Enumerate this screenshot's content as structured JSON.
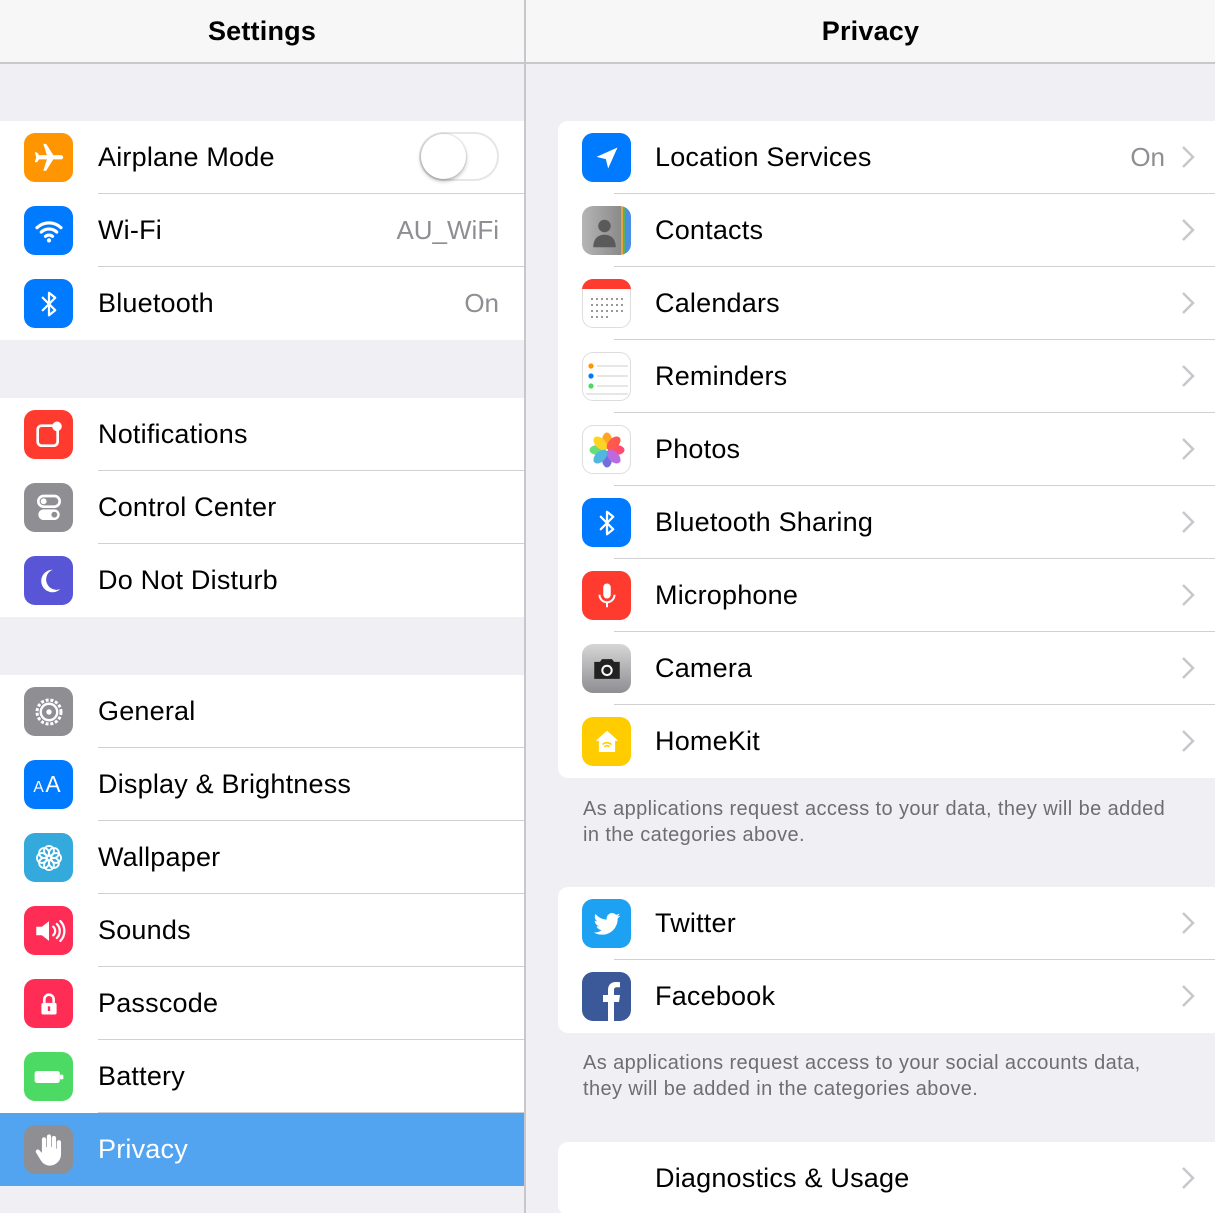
{
  "left": {
    "title": "Settings",
    "groups": [
      [
        {
          "label": "Airplane Mode",
          "icon": "airplane-icon",
          "color": "#ff9500",
          "control": "toggle",
          "toggle_on": false
        },
        {
          "label": "Wi-Fi",
          "icon": "wifi-icon",
          "color": "#007aff",
          "value": "AU_WiFi"
        },
        {
          "label": "Bluetooth",
          "icon": "bluetooth-icon",
          "color": "#007aff",
          "value": "On"
        }
      ],
      [
        {
          "label": "Notifications",
          "icon": "notifications-icon",
          "color": "#ff3b30"
        },
        {
          "label": "Control Center",
          "icon": "control-center-icon",
          "color": "#8e8e93"
        },
        {
          "label": "Do Not Disturb",
          "icon": "moon-icon",
          "color": "#5856d6"
        }
      ],
      [
        {
          "label": "General",
          "icon": "gear-icon",
          "color": "#8e8e93"
        },
        {
          "label": "Display & Brightness",
          "icon": "display-brightness-icon",
          "color": "#007aff"
        },
        {
          "label": "Wallpaper",
          "icon": "wallpaper-icon",
          "color": "#34aadc"
        },
        {
          "label": "Sounds",
          "icon": "speaker-icon",
          "color": "#ff2d55"
        },
        {
          "label": "Passcode",
          "icon": "lock-icon",
          "color": "#ff2d55"
        },
        {
          "label": "Battery",
          "icon": "battery-icon",
          "color": "#4cd964"
        },
        {
          "label": "Privacy",
          "icon": "hand-icon",
          "color": "#8e8e93",
          "selected": true
        }
      ]
    ]
  },
  "right": {
    "title": "Privacy",
    "group1": [
      {
        "label": "Location Services",
        "icon": "location-arrow-icon",
        "color": "#007aff",
        "value": "On"
      },
      {
        "label": "Contacts",
        "icon": "contacts-icon",
        "color": "#9a9a9a"
      },
      {
        "label": "Calendars",
        "icon": "calendar-icon",
        "color": "#ffffff"
      },
      {
        "label": "Reminders",
        "icon": "reminders-icon",
        "color": "#ffffff"
      },
      {
        "label": "Photos",
        "icon": "photos-icon",
        "color": "#ffffff"
      },
      {
        "label": "Bluetooth Sharing",
        "icon": "bluetooth-icon",
        "color": "#007aff"
      },
      {
        "label": "Microphone",
        "icon": "microphone-icon",
        "color": "#ff3b30"
      },
      {
        "label": "Camera",
        "icon": "camera-icon",
        "color": "#8e8e93"
      },
      {
        "label": "HomeKit",
        "icon": "homekit-icon",
        "color": "#ffcc00"
      }
    ],
    "footer1": "As applications request access to your data, they will be added in the categories above.",
    "group2": [
      {
        "label": "Twitter",
        "icon": "twitter-icon",
        "color": "#1da1f2"
      },
      {
        "label": "Facebook",
        "icon": "facebook-icon",
        "color": "#3b5998"
      }
    ],
    "footer2": "As applications request access to your social accounts data, they will be added in the categories above.",
    "group3": [
      {
        "label": "Diagnostics & Usage"
      }
    ]
  }
}
